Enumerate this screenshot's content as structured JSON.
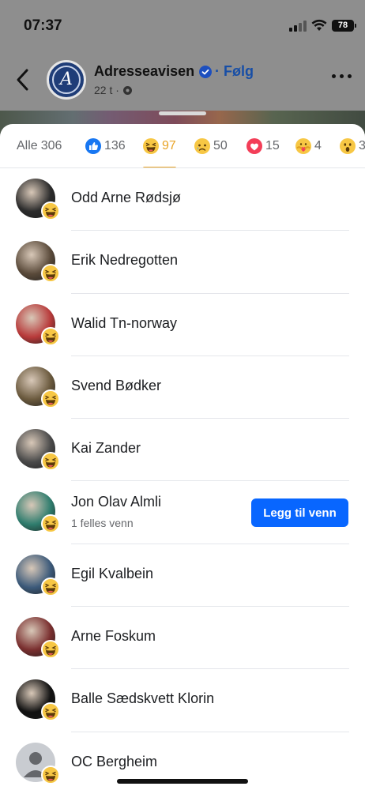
{
  "status_bar": {
    "time": "07:37",
    "battery": "78"
  },
  "post": {
    "page_name": "Adresseavisen",
    "follow_label": "· Følg",
    "time_ago": "22 t ·",
    "avatar_letter": "A"
  },
  "tabs": [
    {
      "label": "Alle",
      "count": "306",
      "icon": "none"
    },
    {
      "label": "",
      "count": "136",
      "icon": "like-icon"
    },
    {
      "label": "",
      "count": "97",
      "icon": "haha-icon"
    },
    {
      "label": "",
      "count": "50",
      "icon": "sad-icon"
    },
    {
      "label": "",
      "count": "15",
      "icon": "love-icon"
    },
    {
      "label": "",
      "count": "4",
      "icon": "care-icon"
    },
    {
      "label": "",
      "count": "3",
      "icon": "wow-icon"
    }
  ],
  "people": [
    {
      "name": "Odd Arne Rødsjø",
      "subtitle": "",
      "avatar_color": "#2b2b2b"
    },
    {
      "name": "Erik Nedregotten",
      "subtitle": "",
      "avatar_color": "#5a4a3a"
    },
    {
      "name": "Walid Tn-norway",
      "subtitle": "",
      "avatar_color": "#b83a3a"
    },
    {
      "name": "Svend Bødker",
      "subtitle": "",
      "avatar_color": "#6b5a3e"
    },
    {
      "name": "Kai Zander",
      "subtitle": "",
      "avatar_color": "#4a4a4a"
    },
    {
      "name": "Jon Olav Almli",
      "subtitle": "1 felles venn",
      "avatar_color": "#2f7d6e",
      "action_label": "Legg til venn"
    },
    {
      "name": "Egil Kvalbein",
      "subtitle": "",
      "avatar_color": "#3c5a7a"
    },
    {
      "name": "Arne Foskum",
      "subtitle": "",
      "avatar_color": "#7a2f2f"
    },
    {
      "name": "Balle Sædskvett Klorin",
      "subtitle": "",
      "avatar_color": "#111111"
    },
    {
      "name": "OC Bergheim",
      "subtitle": "",
      "avatar_color": "#c9ccd1"
    }
  ],
  "colors": {
    "accent": "#0866ff",
    "haha_tab": "#e9a426",
    "follow": "#174ea6"
  }
}
